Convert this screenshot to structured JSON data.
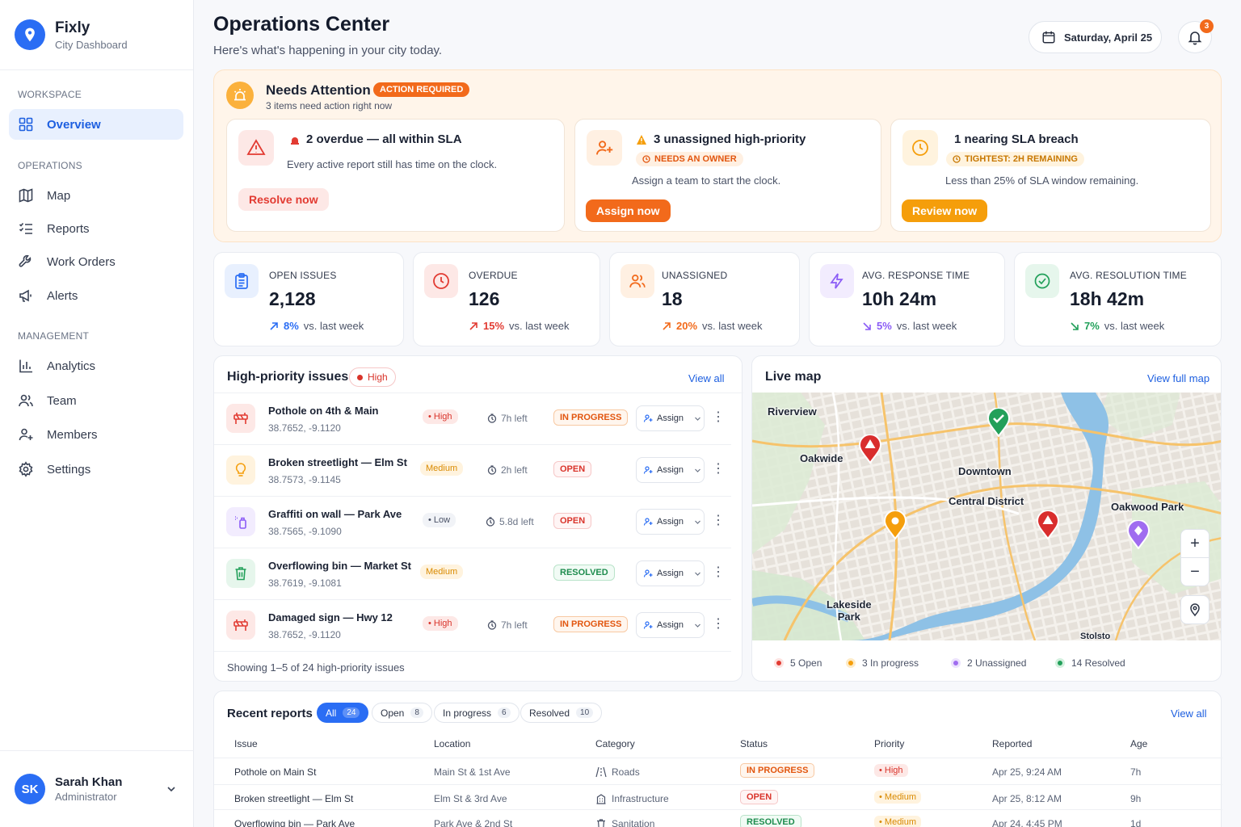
{
  "app": {
    "name": "Fixly",
    "subtitle": "City Dashboard"
  },
  "sidebar": {
    "sections": {
      "workspace": "WORKSPACE",
      "operations": "OPERATIONS",
      "management": "MANAGEMENT"
    },
    "items": [
      {
        "label": "Overview",
        "icon": "grid-icon",
        "active": true
      },
      {
        "label": "Map",
        "icon": "map-icon"
      },
      {
        "label": "Reports",
        "icon": "checklist-icon"
      },
      {
        "label": "Work Orders",
        "icon": "wrench-icon"
      },
      {
        "label": "Alerts",
        "icon": "megaphone-icon"
      },
      {
        "label": "Analytics",
        "icon": "bar-chart-icon"
      },
      {
        "label": "Team",
        "icon": "users-icon"
      },
      {
        "label": "Members",
        "icon": "user-plus-icon"
      },
      {
        "label": "Settings",
        "icon": "gear-icon"
      }
    ],
    "user": {
      "initials": "SK",
      "name": "Sarah Khan",
      "role": "Administrator"
    }
  },
  "header": {
    "title": "Operations Center",
    "subtitle": "Here's what's happening in your city today.",
    "date": "Saturday, April 25",
    "notifications": "3"
  },
  "attention": {
    "title": "Needs Attention",
    "badge": "ACTION REQUIRED",
    "subtitle": "3 items need action right now",
    "cards": [
      {
        "headline": "2 overdue — all within SLA",
        "tag": "",
        "description": "Every active report still has time on the clock.",
        "button": "Resolve now"
      },
      {
        "headline": "3 unassigned high-priority",
        "tag": "NEEDS AN OWNER",
        "description": "Assign a team to start the clock.",
        "button": "Assign now"
      },
      {
        "headline": "1 nearing SLA breach",
        "tag": "TIGHTEST: 2H REMAINING",
        "description": "Less than 25% of SLA window remaining.",
        "button": "Review now"
      }
    ]
  },
  "stats": [
    {
      "label": "OPEN ISSUES",
      "value": "2,128",
      "change": "8%",
      "trend": "up",
      "suffix": "vs. last week",
      "color": "#2a6df4"
    },
    {
      "label": "OVERDUE",
      "value": "126",
      "change": "15%",
      "trend": "up",
      "suffix": "vs. last week",
      "color": "#e23b32"
    },
    {
      "label": "UNASSIGNED",
      "value": "18",
      "change": "20%",
      "trend": "up",
      "suffix": "vs. last week",
      "color": "#f26a1b"
    },
    {
      "label": "AVG. RESPONSE TIME",
      "value": "10h 24m",
      "change": "5%",
      "trend": "down",
      "suffix": "vs. last week",
      "color": "#8b5cf6"
    },
    {
      "label": "AVG. RESOLUTION TIME",
      "value": "18h 42m",
      "change": "7%",
      "trend": "down",
      "suffix": "vs. last week",
      "color": "#22a05a"
    }
  ],
  "high_priority": {
    "title": "High-priority issues",
    "filter": "High",
    "view_all": "View all",
    "rows": [
      {
        "name": "Pothole on 4th & Main",
        "coords": "38.7652, -9.1120",
        "priority": "• High",
        "time": "7h left",
        "status": "IN PROGRESS",
        "assign": "Assign",
        "icon": "barrier-icon"
      },
      {
        "name": "Broken streetlight — Elm St",
        "coords": "38.7573, -9.1145",
        "priority": "Medium",
        "time": "2h left",
        "status": "OPEN",
        "assign": "Assign",
        "icon": "lightbulb-icon"
      },
      {
        "name": "Graffiti on wall — Park Ave",
        "coords": "38.7565, -9.1090",
        "priority": "• Low",
        "time": "5.8d left",
        "status": "OPEN",
        "assign": "Assign",
        "icon": "spray-can-icon"
      },
      {
        "name": "Overflowing bin — Market St",
        "coords": "38.7619, -9.1081",
        "priority": "Medium",
        "time": "",
        "status": "RESOLVED",
        "assign": "Assign",
        "icon": "trash-icon"
      },
      {
        "name": "Damaged sign — Hwy 12",
        "coords": "38.7652, -9.1120",
        "priority": "• High",
        "time": "7h left",
        "status": "IN PROGRESS",
        "assign": "Assign",
        "icon": "barrier-icon"
      }
    ],
    "footer": "Showing 1–5 of 24 high-priority issues"
  },
  "map": {
    "title": "Live map",
    "link": "View full map",
    "labels": [
      "Riverview",
      "Oakwide",
      "Downtown",
      "Central District",
      "Oakwood Park",
      "Lakeside\nPark",
      "Stolsto"
    ],
    "legend": [
      {
        "label": "5 Open",
        "color": "#e23b32"
      },
      {
        "label": "3 In progress",
        "color": "#f59e0b"
      },
      {
        "label": "2 Unassigned",
        "color": "#a06cf0"
      },
      {
        "label": "14 Resolved",
        "color": "#22a05a"
      }
    ]
  },
  "recent": {
    "title": "Recent reports",
    "view_all": "View all",
    "tabs": [
      {
        "label": "All",
        "count": "24"
      },
      {
        "label": "Open",
        "count": "8"
      },
      {
        "label": "In progress",
        "count": "6"
      },
      {
        "label": "Resolved",
        "count": "10"
      }
    ],
    "columns": [
      "Issue",
      "Location",
      "Category",
      "Status",
      "Priority",
      "Reported",
      "Age"
    ],
    "rows": [
      {
        "issue": "Pothole on Main St",
        "location": "Main St & 1st Ave",
        "category": "Roads",
        "status": "IN PROGRESS",
        "priority": "• High",
        "reported": "Apr 25, 9:24 AM",
        "age": "7h"
      },
      {
        "issue": "Broken streetlight — Elm St",
        "location": "Elm St & 3rd Ave",
        "category": "Infrastructure",
        "status": "OPEN",
        "priority": "• Medium",
        "reported": "Apr 25, 8:12 AM",
        "age": "9h"
      },
      {
        "issue": "Overflowing bin — Park Ave",
        "location": "Park Ave & 2nd St",
        "category": "Sanitation",
        "status": "RESOLVED",
        "priority": "• Medium",
        "reported": "Apr 24, 4:45 PM",
        "age": "1d"
      }
    ]
  }
}
